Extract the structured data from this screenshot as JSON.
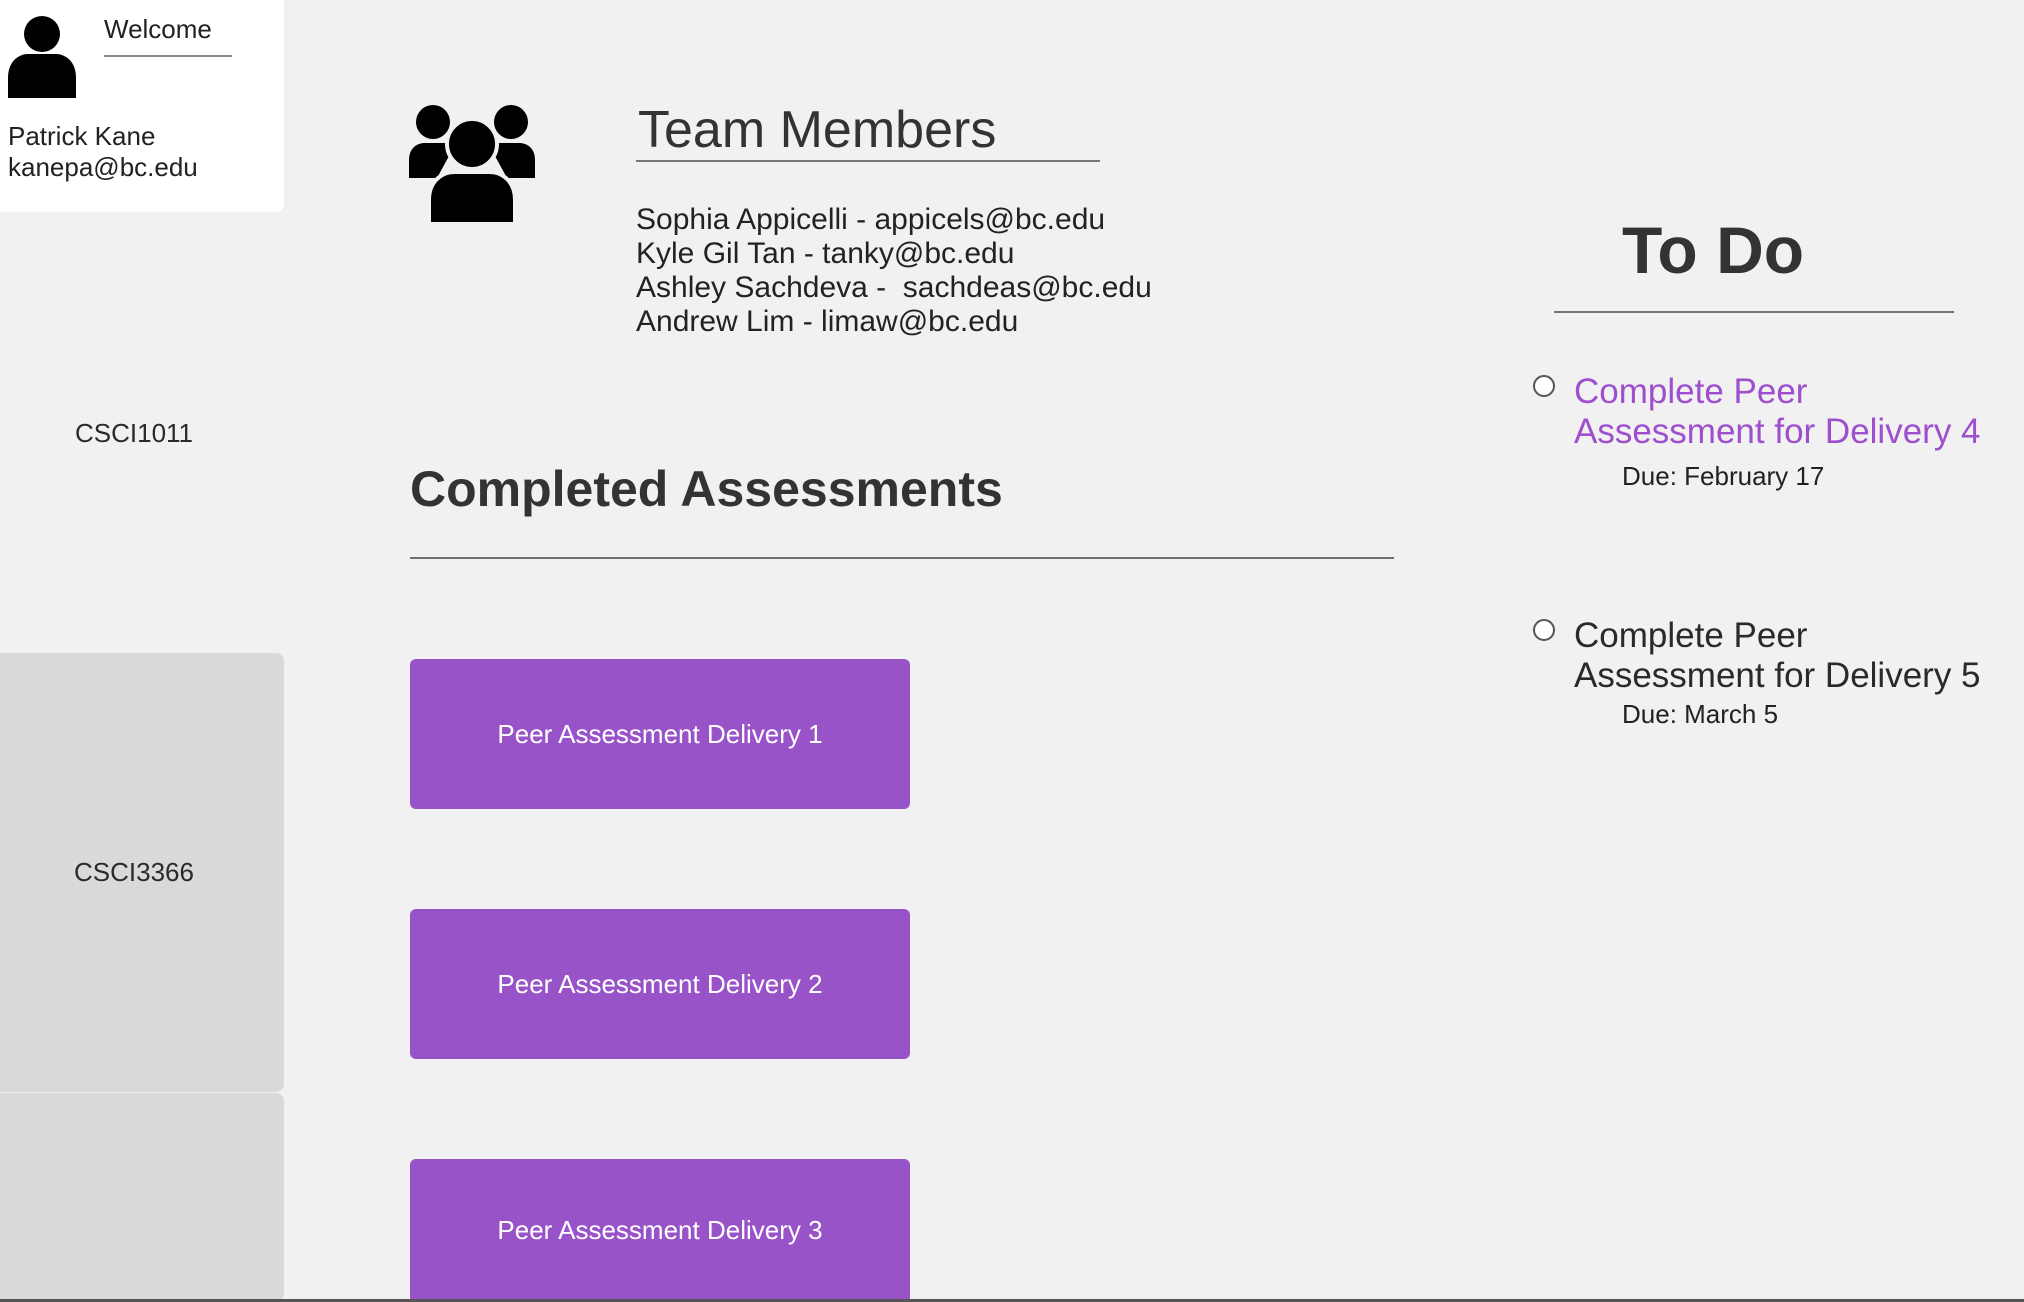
{
  "profile": {
    "welcome": "Welcome",
    "name": "Patrick Kane",
    "email": "kanepa@bc.edu"
  },
  "courses": [
    {
      "label": "CSCI1011"
    },
    {
      "label": "CSCI3366"
    }
  ],
  "team": {
    "title": "Team Members",
    "members": [
      "Sophia Appicelli - appicels@bc.edu",
      "Kyle Gil Tan - tanky@bc.edu",
      "Ashley Sachdeva -  sachdeas@bc.edu",
      "Andrew Lim - limaw@bc.edu"
    ]
  },
  "completed": {
    "title": "Completed Assessments",
    "buttons": [
      "Peer Assessment Delivery 1",
      "Peer Assessment Delivery 2",
      "Peer Assessment Delivery 3"
    ]
  },
  "todo": {
    "title": "To Do",
    "items": [
      {
        "task": "Complete Peer Assessment for Delivery 4",
        "due": "Due: February 17"
      },
      {
        "task": "Complete Peer Assessment for Delivery 5",
        "due": "Due: March 5"
      }
    ]
  },
  "colors": {
    "accent": "#9953c8",
    "link": "#9d4fcd",
    "background": "#f1f1f1",
    "sidebar_active": "#d9d9d9"
  },
  "icons": {
    "avatar": "user-icon",
    "team": "team-icon"
  }
}
